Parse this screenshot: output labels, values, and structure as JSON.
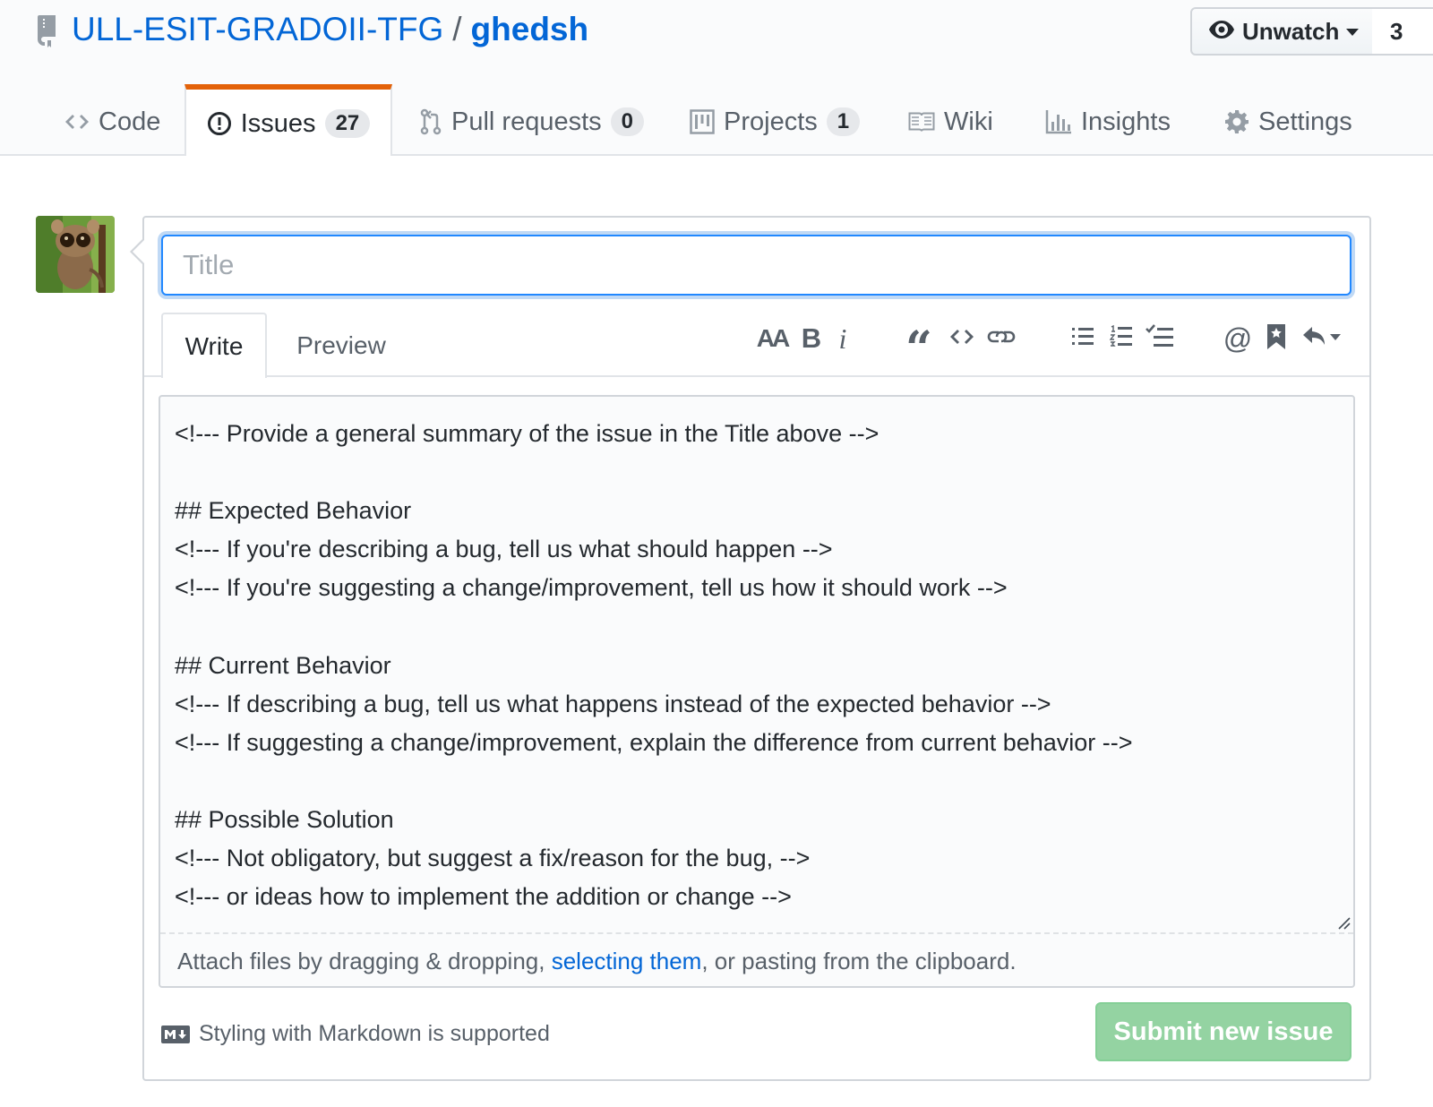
{
  "repo": {
    "owner": "ULL-ESIT-GRADOII-TFG",
    "separator": "/",
    "name": "ghedsh"
  },
  "watch": {
    "label": "Unwatch",
    "count": "3"
  },
  "nav": {
    "code": {
      "label": "Code"
    },
    "issues": {
      "label": "Issues",
      "count": "27"
    },
    "pulls": {
      "label": "Pull requests",
      "count": "0"
    },
    "projects": {
      "label": "Projects",
      "count": "1"
    },
    "wiki": {
      "label": "Wiki"
    },
    "insights": {
      "label": "Insights"
    },
    "settings": {
      "label": "Settings"
    }
  },
  "form": {
    "title_placeholder": "Title",
    "title_value": "",
    "tabs": {
      "write": "Write",
      "preview": "Preview"
    },
    "toolbar": {
      "heading": "AA",
      "bold": "B",
      "italic": "i",
      "quote": "“",
      "mention": "@"
    },
    "body_lines": [
      "<!--- Provide a general summary of the issue in the Title above -->",
      "",
      "## Expected Behavior",
      "<!--- If you're describing a bug, tell us what should happen -->",
      "<!--- If you're suggesting a change/improvement, tell us how it should work -->",
      "",
      "## Current Behavior",
      "<!--- If describing a bug, tell us what happens instead of the expected behavior -->",
      "<!--- If suggesting a change/improvement, explain the difference from current behavior -->",
      "",
      "## Possible Solution",
      "<!--- Not obligatory, but suggest a fix/reason for the bug, -->",
      "<!--- or ideas how to implement the addition or change -->"
    ],
    "attach": {
      "before": "Attach files by dragging & dropping, ",
      "link": "selecting them",
      "after": ", or pasting from the clipboard."
    },
    "markdown_note": "Styling with Markdown is supported",
    "submit_label": "Submit new issue"
  },
  "colors": {
    "link": "#0366d6",
    "selected_tab_accent": "#e36209",
    "submit_disabled": "#94d3a2",
    "focus": "#2188ff"
  },
  "icons": [
    "repo-icon",
    "eye-icon",
    "code-icon",
    "issue-opened-icon",
    "git-pull-request-icon",
    "project-icon",
    "book-icon",
    "graph-icon",
    "gear-icon",
    "markdown-icon",
    "link-icon",
    "list-unordered-icon",
    "list-ordered-icon",
    "tasklist-icon",
    "bookmark-icon",
    "reply-icon"
  ]
}
